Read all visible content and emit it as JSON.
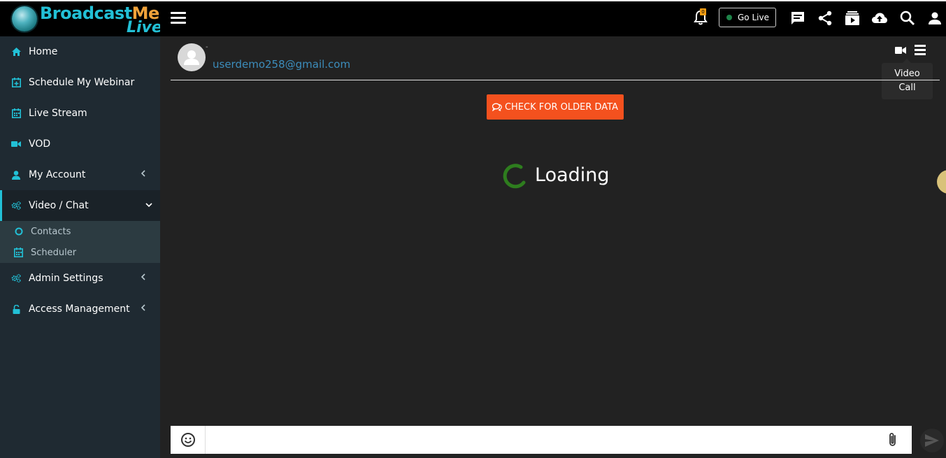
{
  "app": {
    "brand_part1": "Broadcast",
    "brand_part2": "Me",
    "brand_part3": "Live"
  },
  "header": {
    "notification_count": "0",
    "go_live_label": "Go Live",
    "icons": [
      "menu-icon",
      "bell-icon",
      "chat-icon",
      "share-icon",
      "playlist-icon",
      "upload-cloud-icon",
      "search-icon",
      "user-icon"
    ]
  },
  "sidebar": {
    "items": [
      {
        "label": "Home",
        "icon": "home-icon"
      },
      {
        "label": "Schedule My Webinar",
        "icon": "calendar-plus-icon"
      },
      {
        "label": "Live Stream",
        "icon": "calendar-icon"
      },
      {
        "label": "VOD",
        "icon": "video-camera-icon"
      },
      {
        "label": "My Account",
        "icon": "user-icon"
      },
      {
        "label": "Video / Chat",
        "icon": "cogs-icon"
      },
      {
        "label": "Admin Settings",
        "icon": "cogs-icon"
      },
      {
        "label": "Access Management",
        "icon": "unlock-icon"
      }
    ],
    "subitems": [
      {
        "label": "Contacts",
        "icon": "circle-icon"
      },
      {
        "label": "Scheduler",
        "icon": "calendar-icon"
      }
    ]
  },
  "chat": {
    "contact_name": "-",
    "contact_email": "userdemo258@gmail.com",
    "tooltip_line1": "Video",
    "tooltip_line2": "Call",
    "older_button_label": "CHECK FOR OLDER DATA",
    "loading_label": "Loading",
    "message_placeholder": ""
  },
  "colors": {
    "accent": "#22c0d6",
    "sidebar_bg": "#1f2a32",
    "header_bg": "#000000",
    "older_button": "#f4511e",
    "spinner": "#2e7d1e",
    "email_link": "#3c8dbc",
    "badge": "#f39c12"
  }
}
